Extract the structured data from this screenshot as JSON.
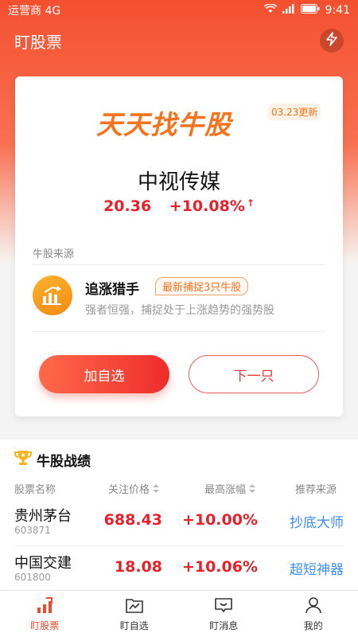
{
  "status_bar": {
    "carrier": "运营商 4G",
    "time": "9:41"
  },
  "header": {
    "title": "盯股票",
    "action_icon": "flash-icon"
  },
  "card": {
    "brand": "天天找牛股",
    "update_tag": "03.23更新",
    "stock_name": "中视传媒",
    "price": "20.36",
    "change": "+10.08%",
    "source_label": "牛股来源",
    "source": {
      "name": "追涨猎手",
      "tag": "最新捕捉3只牛股",
      "description": "强者恒强，捕捉处于上涨趋势的强势股"
    },
    "add_button": "加自选",
    "next_button": "下一只"
  },
  "performance": {
    "title": "牛股战绩",
    "columns": [
      "股票名称",
      "关注价格",
      "最高涨幅",
      "推荐来源"
    ],
    "rows": [
      {
        "name": "贵州茅台",
        "code": "603871",
        "price": "688.43",
        "rise": "+10.00%",
        "source": "抄底大师"
      },
      {
        "name": "中国交建",
        "code": "601800",
        "price": "18.08",
        "rise": "+10.06%",
        "source": "超短神器"
      }
    ]
  },
  "tabs": [
    {
      "label": "盯股票",
      "icon": "trend-bars-icon",
      "active": true
    },
    {
      "label": "盯自选",
      "icon": "chart-folder-icon",
      "active": false
    },
    {
      "label": "盯消息",
      "icon": "message-icon",
      "active": false
    },
    {
      "label": "我的",
      "icon": "user-icon",
      "active": false
    }
  ],
  "colors": {
    "accent": "#f04a2c",
    "up_red": "#e8202a",
    "link_blue": "#3c8ef5",
    "brand_orange": "#f5731c"
  }
}
